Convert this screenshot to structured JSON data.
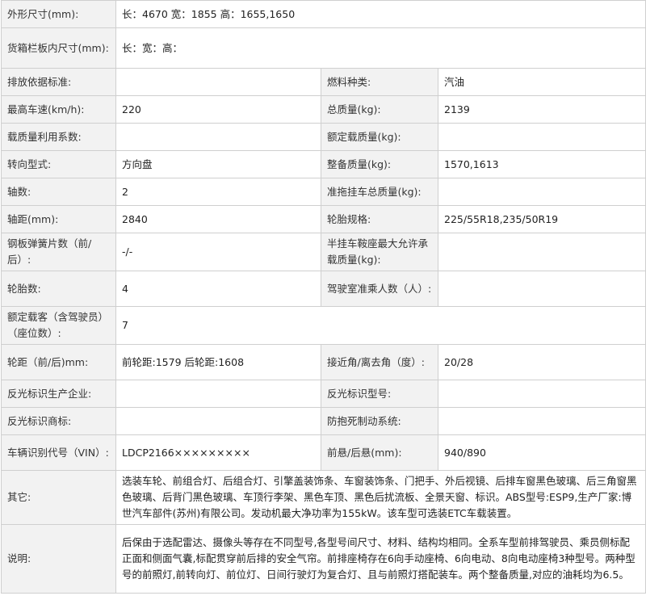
{
  "rows": {
    "dimensions": {
      "label": "外形尺寸(mm):",
      "value": "长：4670 宽：1855 高：1655,1650"
    },
    "cargo_box": {
      "label": "货箱栏板内尺寸(mm):",
      "value": "长：宽：高："
    },
    "emission": {
      "label": "排放依据标准:",
      "value": "",
      "label2": "燃料种类:",
      "value2": "汽油"
    },
    "max_speed": {
      "label": "最高车速(km/h):",
      "value": "220",
      "label2": "总质量(kg):",
      "value2": "2139"
    },
    "load_util": {
      "label": "载质量利用系数:",
      "value": "",
      "label2": "额定载质量(kg):",
      "value2": ""
    },
    "steering": {
      "label": "转向型式:",
      "value": "方向盘",
      "label2": "整备质量(kg):",
      "value2": "1570,1613"
    },
    "axles": {
      "label": "轴数:",
      "value": "2",
      "label2": "准拖挂车总质量(kg):",
      "value2": ""
    },
    "wheelbase": {
      "label": "轴距(mm):",
      "value": "2840",
      "label2": "轮胎规格:",
      "value2": "225/55R18,235/50R19"
    },
    "leaf_spring": {
      "label": "钢板弹簧片数（前/后）:",
      "value": "-/-",
      "label2": "半挂车鞍座最大允许承载质量(kg):",
      "value2": ""
    },
    "tires": {
      "label": "轮胎数:",
      "value": "4",
      "label2": "驾驶室准乘人数（人）:",
      "value2": ""
    },
    "seats": {
      "label": "额定载客（含驾驶员）（座位数）:",
      "value": "7"
    },
    "track": {
      "label": "轮距（前/后)mm:",
      "value": "前轮距:1579 后轮距:1608",
      "label2": "接近角/离去角（度）:",
      "value2": "20/28"
    },
    "reflector_maker": {
      "label": "反光标识生产企业:",
      "value": "",
      "label2": "反光标识型号:",
      "value2": ""
    },
    "reflector_brand": {
      "label": "反光标识商标:",
      "value": "",
      "label2": "防抱死制动系统:",
      "value2": ""
    },
    "vin": {
      "label": "车辆识别代号（VIN）:",
      "value": "LDCP2166×××××××××",
      "label2": "前悬/后悬(mm):",
      "value2": "940/890"
    },
    "other": {
      "label": "其它:",
      "value": "选装车轮、前组合灯、后组合灯、引擎盖装饰条、车窗装饰条、门把手、外后视镜、后排车窗黑色玻璃、后三角窗黑色玻璃、后背门黑色玻璃、车顶行李架、黑色车顶、黑色后扰流板、全景天窗、标识。ABS型号:ESP9,生产厂家:博世汽车部件(苏州)有限公司。发动机最大净功率为155kW。该车型可选装ETC车载装置。"
    },
    "notes": {
      "label": "说明:",
      "value": "后保由于选配雷达、摄像头等存在不同型号,各型号间尺寸、材料、结构均相同。全系车型前排驾驶员、乘员侧标配正面和侧面气囊,标配贯穿前后排的安全气帘。前排座椅存在6向手动座椅、6向电动、8向电动座椅3种型号。两种型号的前照灯,前转向灯、前位灯、日间行驶灯为复合灯、且与前照灯搭配装车。两个整备质量,对应的油耗均为6.5。"
    }
  }
}
